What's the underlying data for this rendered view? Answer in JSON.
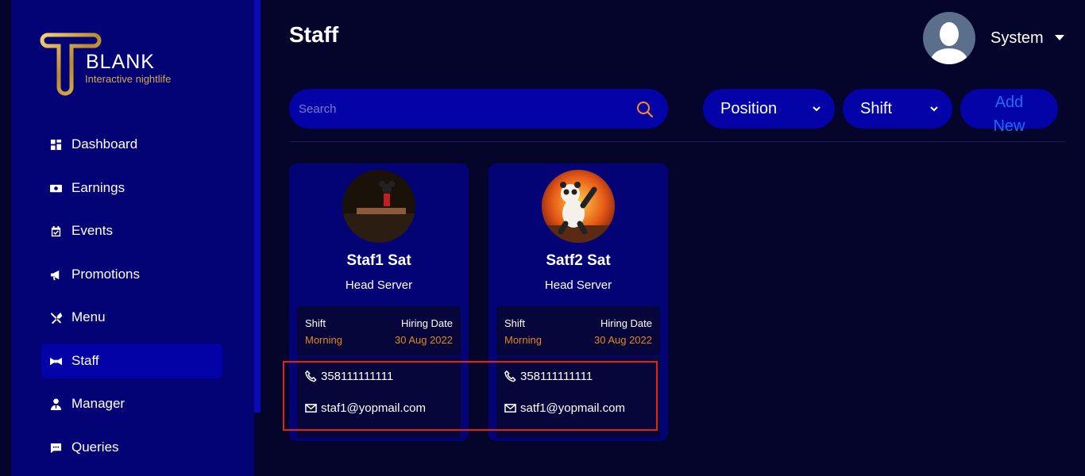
{
  "brand": {
    "name": "BLANK",
    "tagline": "Interactive nightlife",
    "accent": "#d4a84b"
  },
  "sidebar": {
    "items": [
      {
        "label": "Dashboard",
        "icon": "dashboard-icon"
      },
      {
        "label": "Earnings",
        "icon": "cash-icon"
      },
      {
        "label": "Events",
        "icon": "calendar-icon"
      },
      {
        "label": "Promotions",
        "icon": "megaphone-icon"
      },
      {
        "label": "Menu",
        "icon": "utensils-icon"
      },
      {
        "label": "Staff",
        "icon": "bowtie-icon",
        "active": true
      },
      {
        "label": "Manager",
        "icon": "user-tie-icon"
      },
      {
        "label": "Queries",
        "icon": "message-icon"
      }
    ]
  },
  "header": {
    "title": "Staff",
    "user": "System"
  },
  "toolbar": {
    "search_placeholder": "Search",
    "position_label": "Position",
    "shift_label": "Shift",
    "add_line1": "Add",
    "add_line2": "New"
  },
  "staff": [
    {
      "name": "Staf1 Sat",
      "role": "Head Server",
      "shift_label": "Shift",
      "shift": "Morning",
      "hiring_label": "Hiring Date",
      "hiring_date": "30 Aug 2022",
      "phone": "358111111111",
      "email": "staf1@yopmail.com"
    },
    {
      "name": "Satf2 Sat",
      "role": "Head Server",
      "shift_label": "Shift",
      "shift": "Morning",
      "hiring_label": "Hiring Date",
      "hiring_date": "30 Aug 2022",
      "phone": "358111111111",
      "email": "satf1@yopmail.com"
    }
  ],
  "colors": {
    "background": "#05052c",
    "sidebar": "#030376",
    "control": "#0303a8",
    "highlight": "#e0221b",
    "orange": "#e08a1e"
  }
}
